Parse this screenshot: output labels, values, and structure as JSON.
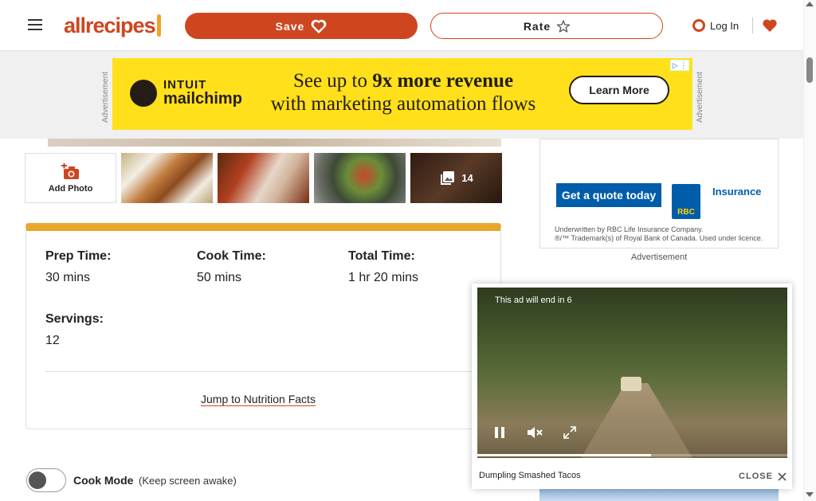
{
  "header": {
    "menu_icon": "hamburger-menu-icon",
    "logo_text": "allrecipes",
    "save_label": "Save",
    "save_icon": "heart-icon",
    "rate_label": "Rate",
    "rate_icon": "star-icon",
    "login_label": "Log In",
    "login_icon": "person-icon",
    "saved_icon": "heart-icon"
  },
  "top_ad": {
    "side_label": "Advertisement",
    "brand_top": "INTUIT",
    "brand_name": "mailchimp",
    "headline_a": "See up to ",
    "headline_b": "9x more revenue",
    "headline_c": "with marketing automation flows",
    "cta": "Learn More",
    "adchoices": "▷ ⋮"
  },
  "photos": {
    "add_label": "Add Photo",
    "add_icon": "camera-plus-icon",
    "more_count": "14",
    "more_icon": "gallery-icon"
  },
  "details": {
    "prep_label": "Prep Time:",
    "prep_value": "30 mins",
    "cook_label": "Cook Time:",
    "cook_value": "50 mins",
    "total_label": "Total Time:",
    "total_value": "1 hr 20 mins",
    "servings_label": "Servings:",
    "servings_value": "12",
    "jump_link": "Jump to Nutrition Facts",
    "accent_color": "#e8a62d"
  },
  "cook_mode": {
    "label": "Cook Mode",
    "sublabel": "(Keep screen awake)",
    "enabled": false
  },
  "right_ad": {
    "quote_button": "Get a quote today",
    "logo_text": "RBC",
    "insurance_label": "Insurance",
    "fine_print_1": "Underwritten by RBC Life Insurance Company.",
    "fine_print_2": "®/™ Trademark(s) of Royal Bank of Canada. Used under licence.",
    "ad_label": "Advertisement"
  },
  "video_ad": {
    "countdown_text": "This ad will end in 6",
    "progress": 0.56,
    "pause_icon": "pause-icon",
    "mute_icon": "muted-speaker-icon",
    "fullscreen_icon": "fullscreen-icon",
    "title": "Dumpling Smashed Tacos",
    "close_label": "CLOSE",
    "close_icon": "close-icon"
  },
  "colors": {
    "brand": "#ce4620",
    "mailchimp_yellow": "#ffe01b",
    "rbc_blue": "#005daa"
  }
}
